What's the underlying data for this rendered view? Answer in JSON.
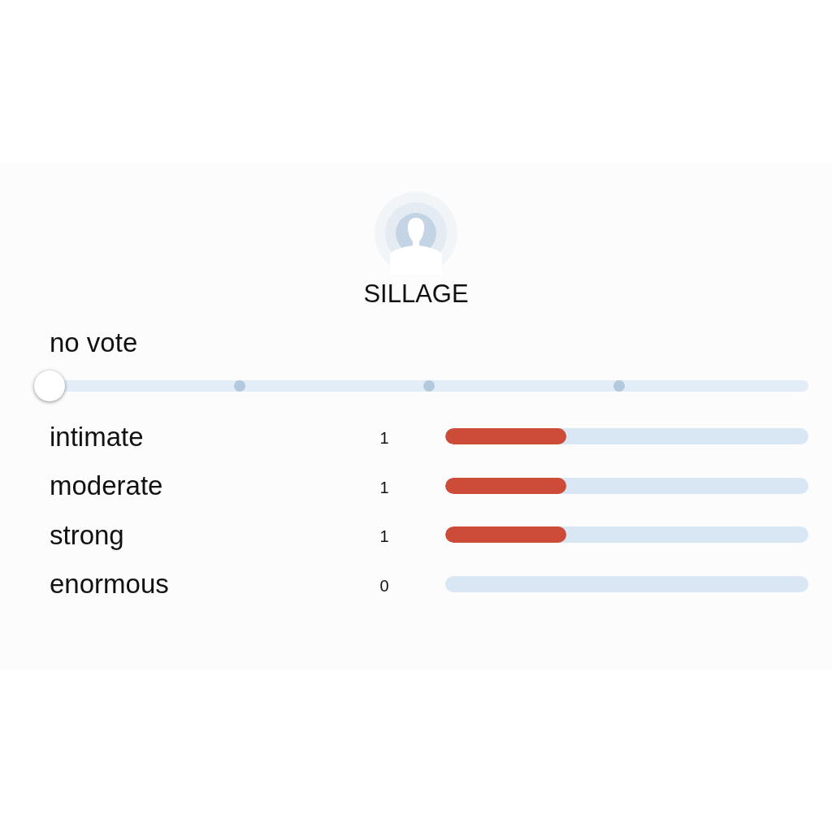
{
  "section": {
    "title": "SILLAGE"
  },
  "vote": {
    "label": "no vote",
    "level": 0
  },
  "results": [
    {
      "label": "intimate",
      "count": "1",
      "level": 0.333
    },
    {
      "label": "moderate",
      "count": "1",
      "level": 0.333
    },
    {
      "label": "strong",
      "count": "1",
      "level": 0.333
    },
    {
      "label": "enormous",
      "count": "0"
    }
  ]
}
